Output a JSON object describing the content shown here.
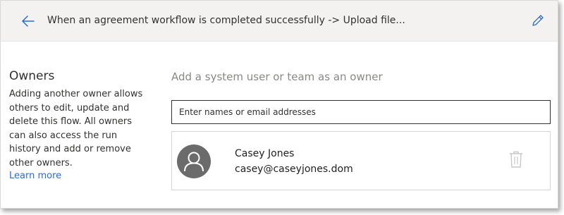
{
  "header": {
    "title": "When an agreement workflow is completed successfully -> Upload file...",
    "back_icon": "back-arrow-icon",
    "edit_icon": "pencil-icon"
  },
  "sidebar": {
    "heading": "Owners",
    "description": "Adding another owner allows others to edit, update and delete this flow. All owners can also access the run history and add or remove other owners.",
    "learn_more": "Learn more"
  },
  "main": {
    "heading": "Add a system user or team as an owner",
    "search": {
      "placeholder": "Enter names or email addresses",
      "value": ""
    },
    "owners": [
      {
        "name": "Casey Jones",
        "email": "casey@caseyjones.dom",
        "avatar_icon": "person-icon",
        "delete_icon": "trash-icon"
      }
    ]
  },
  "colors": {
    "header_bg": "#f3f2f1",
    "link": "#2b6cc8",
    "avatar_bg": "#6b6b6b",
    "muted_heading": "#8a8886"
  }
}
